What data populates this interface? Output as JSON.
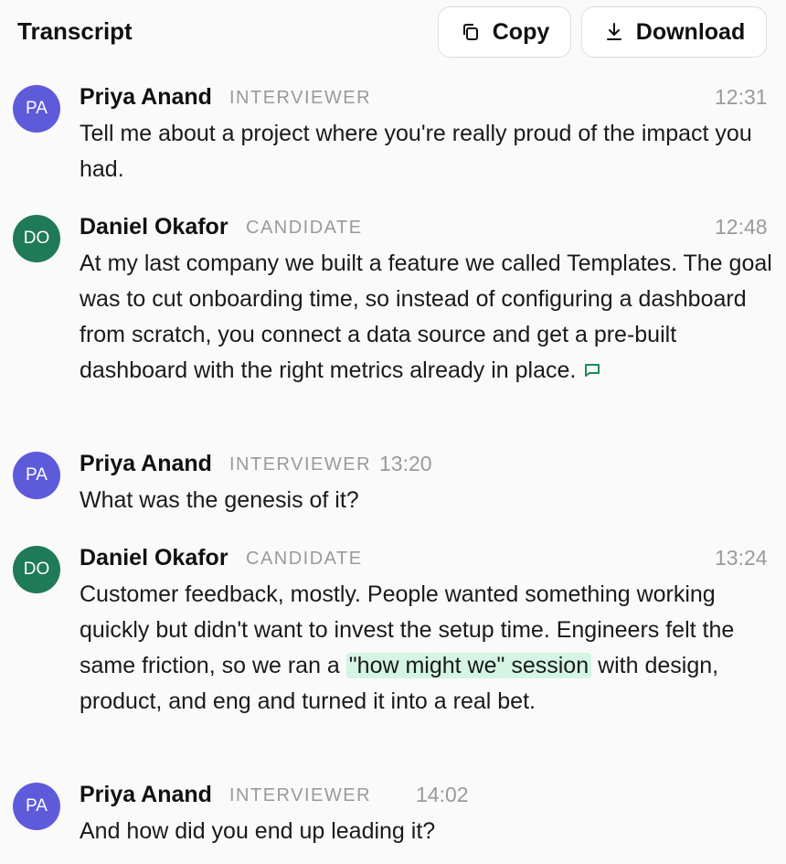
{
  "header": {
    "title": "Transcript",
    "copy_label": "Copy",
    "download_label": "Download"
  },
  "messages": [
    {
      "initials": "PA",
      "name": "Priya Anand",
      "role": "INTERVIEWER",
      "time": "12:31",
      "text": "Tell me about a project where you're really proud of the impact you had."
    },
    {
      "initials": "DO",
      "name": "Daniel Okafor",
      "role": "CANDIDATE",
      "time": "12:48",
      "text": "At my last company we built a feature we called Templates. The goal was to cut onboarding time, so instead of configuring a dashboard from scratch, you connect a data source and get a pre-built dashboard with the right metrics already in place."
    },
    {
      "initials": "PA",
      "name": "Priya Anand",
      "role": "INTERVIEWER",
      "time": "13:20",
      "text": "What was the genesis of it?"
    },
    {
      "initials": "DO",
      "name": "Daniel Okafor",
      "role": "CANDIDATE",
      "time": "13:24",
      "text_before": "Customer feedback, mostly. People wanted something working quickly but didn't want to invest the setup time. Engineers felt the same friction, so we ran a",
      "highlight": "\"how might we\" session",
      "text_after": "with design, product, and eng and turned it into a real bet."
    },
    {
      "initials": "PA",
      "name": "Priya Anand",
      "role": "INTERVIEWER",
      "time": "14:02",
      "text": "And how did you end up leading it?"
    }
  ],
  "colors": {
    "interviewer_avatar": "#5e5bdb",
    "candidate_avatar": "#1f7a57",
    "highlight": "#d4f5e3"
  },
  "icons": {
    "copy": "copy-icon",
    "download": "download-icon",
    "comment": "comment-icon"
  }
}
